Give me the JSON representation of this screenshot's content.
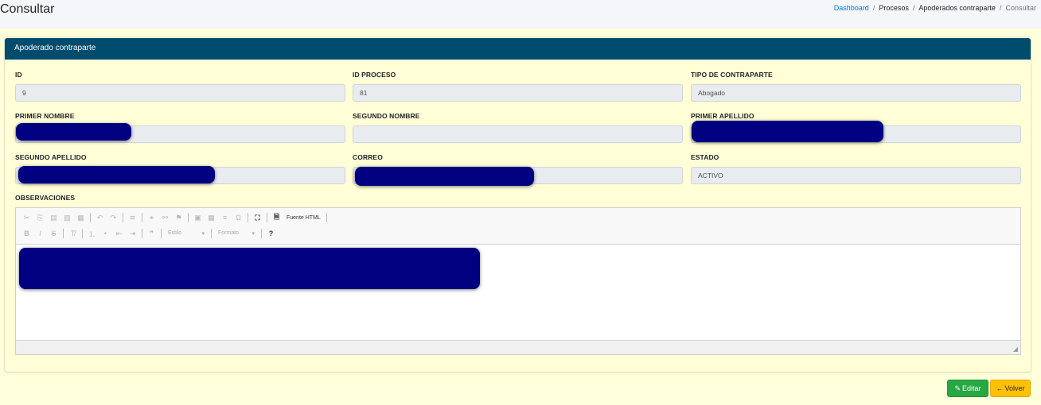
{
  "header": {
    "title": "Consultar",
    "breadcrumb": [
      "Dashboard",
      "Procesos",
      "Apoderados contraparte",
      "Consultar"
    ]
  },
  "card": {
    "title": "Apoderado contraparte"
  },
  "fields": {
    "id": {
      "label": "ID",
      "value": "9"
    },
    "id_proceso": {
      "label": "ID PROCESO",
      "value": "81"
    },
    "tipo_contraparte": {
      "label": "TIPO DE CONTRAPARTE",
      "value": "Abogado"
    },
    "primer_nombre": {
      "label": "PRIMER NOMBRE",
      "value": ""
    },
    "segundo_nombre": {
      "label": "SEGUNDO NOMBRE",
      "value": ""
    },
    "primer_apellido": {
      "label": "PRIMER APELLIDO",
      "value": ""
    },
    "segundo_apellido": {
      "label": "SEGUNDO APELLIDO",
      "value": ""
    },
    "correo": {
      "label": "CORREO",
      "value": ""
    },
    "estado": {
      "label": "ESTADO",
      "value": "ACTIVO"
    },
    "observaciones": {
      "label": "OBSERVACIONES"
    }
  },
  "editor": {
    "source_label": "Fuente HTML",
    "style_label": "Estilo",
    "format_label": "Formato",
    "help_label": "?"
  },
  "actions": {
    "edit_label": "Editar",
    "back_label": "Volver"
  },
  "colors": {
    "card_header": "#004c6e",
    "page_background": "#fffedb",
    "redaction": "#000080",
    "edit_button": "#28a745",
    "back_button": "#ffc107",
    "breadcrumb_link": "#007bff"
  }
}
